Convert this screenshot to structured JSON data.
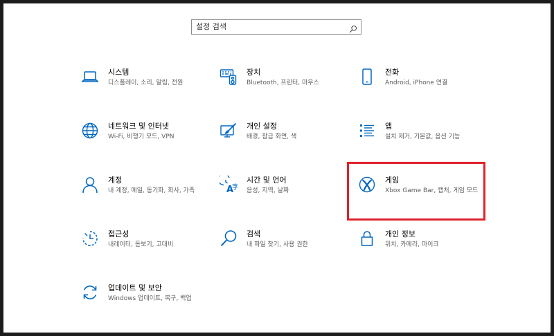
{
  "search": {
    "placeholder": "설정 검색"
  },
  "accent_color": "#0067c0",
  "highlight_color": "#e0202a",
  "tiles": [
    {
      "title": "시스템",
      "desc": "디스플레이, 소리, 알림, 전원",
      "icon": "laptop-icon"
    },
    {
      "title": "장치",
      "desc": "Bluetooth, 프린터, 마우스",
      "icon": "devices-icon"
    },
    {
      "title": "전화",
      "desc": "Android, iPhone 연결",
      "icon": "phone-icon"
    },
    {
      "title": "네트워크 및 인터넷",
      "desc": "Wi-Fi, 비행기 모드, VPN",
      "icon": "globe-icon"
    },
    {
      "title": "개인 설정",
      "desc": "배경, 잠금 화면, 색",
      "icon": "personalization-icon"
    },
    {
      "title": "앱",
      "desc": "설치 제거, 기본값, 옵션 기능",
      "icon": "apps-list-icon"
    },
    {
      "title": "계정",
      "desc": "내 계정, 메일, 동기화, 회사, 가족",
      "icon": "person-icon"
    },
    {
      "title": "시간 및 언어",
      "desc": "음성, 지역, 날짜",
      "icon": "time-language-icon"
    },
    {
      "title": "게임",
      "desc": "Xbox Game Bar, 캡처, 게임 모드",
      "icon": "xbox-icon"
    },
    {
      "title": "접근성",
      "desc": "내레이터, 돋보기, 고대비",
      "icon": "ease-of-access-icon"
    },
    {
      "title": "검색",
      "desc": "내 파일 찾기, 사용 권한",
      "icon": "search-icon"
    },
    {
      "title": "개인 정보",
      "desc": "위치, 카메라, 마이크",
      "icon": "lock-icon"
    },
    {
      "title": "업데이트 및 보안",
      "desc": "Windows 업데이트, 복구, 백업",
      "icon": "update-icon"
    }
  ]
}
